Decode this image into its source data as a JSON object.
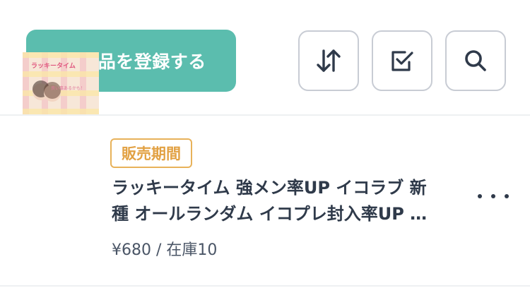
{
  "toolbar": {
    "register_label": "商品を登録する",
    "sort_icon": "sort-updown-icon",
    "bulk_select_icon": "checkbox-icon",
    "search_icon": "search-icon"
  },
  "product": {
    "badge": "販売期間",
    "title_line1": "ラッキータイム 強メン率UP イコラブ 新",
    "title_line2": "種 オールランダム イコプレ封入率UP …",
    "price_stock": "¥680 / 在庫10",
    "thumbnail": {
      "title_text": "ラッキータイム",
      "sub_text": "良い事あるかも！"
    }
  },
  "colors": {
    "accent": "#5bbdae",
    "badge": "#e8b25a",
    "text": "#2f3a4a",
    "border": "#c8ccd4"
  }
}
